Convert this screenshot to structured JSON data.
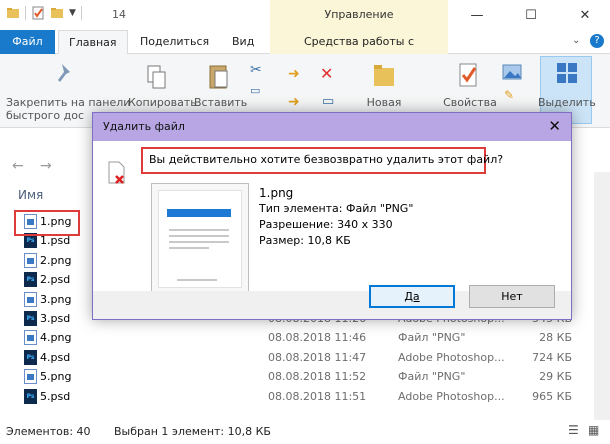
{
  "titlebar": {
    "title": "14",
    "context_tab": "Управление",
    "minimize": "—",
    "maximize": "☐",
    "close": "✕"
  },
  "tabs": {
    "file": "Файл",
    "home": "Главная",
    "share": "Поделиться",
    "view": "Вид",
    "tools": "Средства работы с рисунками"
  },
  "ribbon": {
    "pin_label_1": "Закрепить на панели",
    "pin_label_2": "быстрого дос",
    "copy": "Копировать",
    "paste": "Вставить",
    "new": "Новая",
    "properties": "Свойства",
    "select": "Выделить"
  },
  "list": {
    "header_name": "Имя",
    "rows": [
      {
        "name": "1.png",
        "type_icon": "png",
        "date": "",
        "type": "",
        "size": ""
      },
      {
        "name": "1.psd",
        "type_icon": "psd",
        "date": "",
        "type": "",
        "size": ""
      },
      {
        "name": "2.png",
        "type_icon": "png",
        "date": "",
        "type": "",
        "size": ""
      },
      {
        "name": "2.psd",
        "type_icon": "psd",
        "date": "",
        "type": "",
        "size": ""
      },
      {
        "name": "3.png",
        "type_icon": "png",
        "date": "",
        "type": "",
        "size": ""
      },
      {
        "name": "3.psd",
        "type_icon": "psd",
        "date": "08.08.2018 11:26",
        "type": "Adobe Photoshop...",
        "size": "545 КБ"
      },
      {
        "name": "4.png",
        "type_icon": "png",
        "date": "08.08.2018 11:46",
        "type": "Файл \"PNG\"",
        "size": "28 КБ"
      },
      {
        "name": "4.psd",
        "type_icon": "psd",
        "date": "08.08.2018 11:47",
        "type": "Adobe Photoshop...",
        "size": "724 КБ"
      },
      {
        "name": "5.png",
        "type_icon": "png",
        "date": "08.08.2018 11:52",
        "type": "Файл \"PNG\"",
        "size": "29 КБ"
      },
      {
        "name": "5.psd",
        "type_icon": "psd",
        "date": "08.08.2018 11:51",
        "type": "Adobe Photoshop...",
        "size": "965 КБ"
      }
    ]
  },
  "status": {
    "count": "Элементов: 40",
    "selected": "Выбран 1 элемент: 10,8 КБ"
  },
  "dialog": {
    "title": "Удалить файл",
    "close": "✕",
    "question": "Вы действительно хотите безвозвратно удалить этот файл?",
    "file_name": "1.png",
    "file_type": "Тип элемента: Файл \"PNG\"",
    "resolution": "Разрешение: 340 x 330",
    "size": "Размер: 10,8 КБ",
    "yes": "Да",
    "no": "Нет"
  },
  "colors": {
    "file_tab": "#1979ca",
    "dialog_title": "#b7a6e3",
    "highlight": "#e03b3b"
  }
}
